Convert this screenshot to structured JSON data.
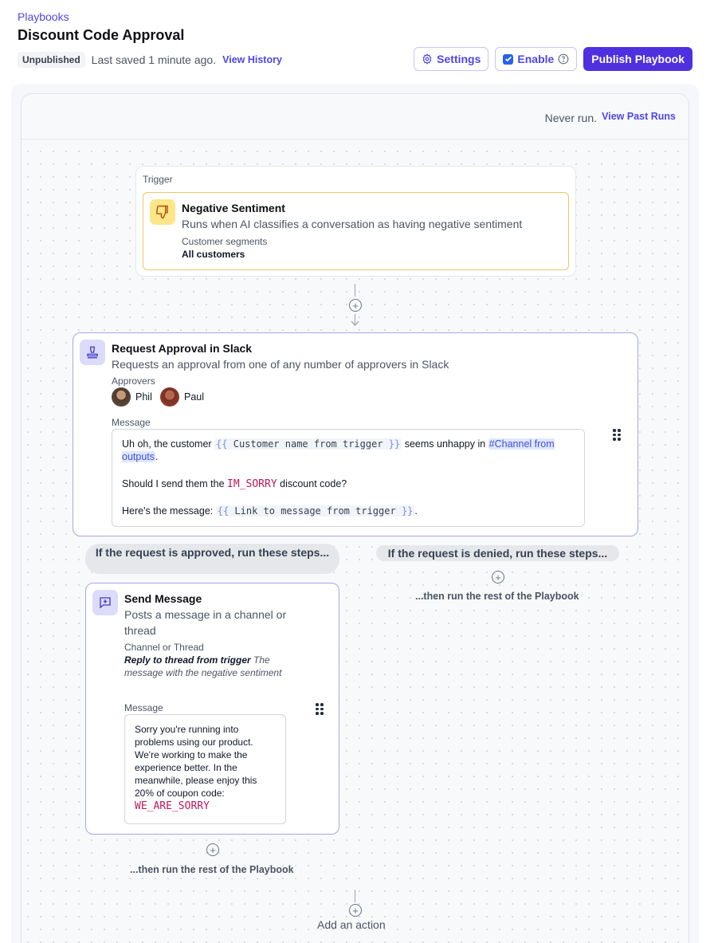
{
  "header": {
    "breadcrumb": "Playbooks",
    "title": "Discount Code Approval",
    "status_badge": "Unpublished",
    "last_saved": "Last saved 1 minute ago.",
    "history_link": "View History",
    "settings_label": "Settings",
    "enable_label": "Enable",
    "enable_checked": true,
    "publish_label": "Publish Playbook"
  },
  "canvas": {
    "never_run": "Never run.",
    "past_runs_link": "View Past Runs"
  },
  "trigger": {
    "section_label": "Trigger",
    "title": "Negative Sentiment",
    "description": "Runs when AI classifies a conversation as having negative sentiment",
    "field_label": "Customer segments",
    "field_value": "All customers",
    "icon": "thumbs-down-icon",
    "accent_color": "#e8c96a"
  },
  "approval": {
    "title": "Request Approval in Slack",
    "description": "Requests an approval from one of any number of approvers in Slack",
    "approvers_label": "Approvers",
    "approvers": [
      {
        "name": "Phil"
      },
      {
        "name": "Paul"
      }
    ],
    "message_label": "Message",
    "message": {
      "line1_a": "Uh oh, the customer ",
      "var1": "Customer name from trigger",
      "line1_b": " seems unhappy in ",
      "channel_var": "#Channel from outputs",
      "line1_c": ".",
      "line2_a": "Should I send them the ",
      "code": "IM_SORRY",
      "line2_b": " discount code?",
      "line3_a": "Here's the message: ",
      "var2": "Link to message from trigger",
      "line3_b": "."
    },
    "icon": "stamp-icon"
  },
  "branches": {
    "approved_label": "If the request is approved, run these steps...",
    "denied_label": "If the request is denied, run these steps...",
    "rest_note": "...then run the rest of the Playbook"
  },
  "send_message": {
    "title": "Send Message",
    "description": "Posts a message in a channel or thread",
    "channel_label": "Channel or Thread",
    "channel_value_bold": "Reply to thread from trigger",
    "channel_value_hint": "The message with the negative sentiment",
    "message_label": "Message",
    "message_text": "Sorry you're running into problems using our product. We're working to make the experience better. In the meanwhile, please enjoy this 20% of coupon code:",
    "message_code": "WE_ARE_SORRY",
    "icon": "message-plus-icon"
  },
  "footer": {
    "add_action": "Add an action"
  },
  "colors": {
    "accent": "#4f46e5",
    "primary_button": "#4f30e0",
    "code_text": "#be185d"
  }
}
